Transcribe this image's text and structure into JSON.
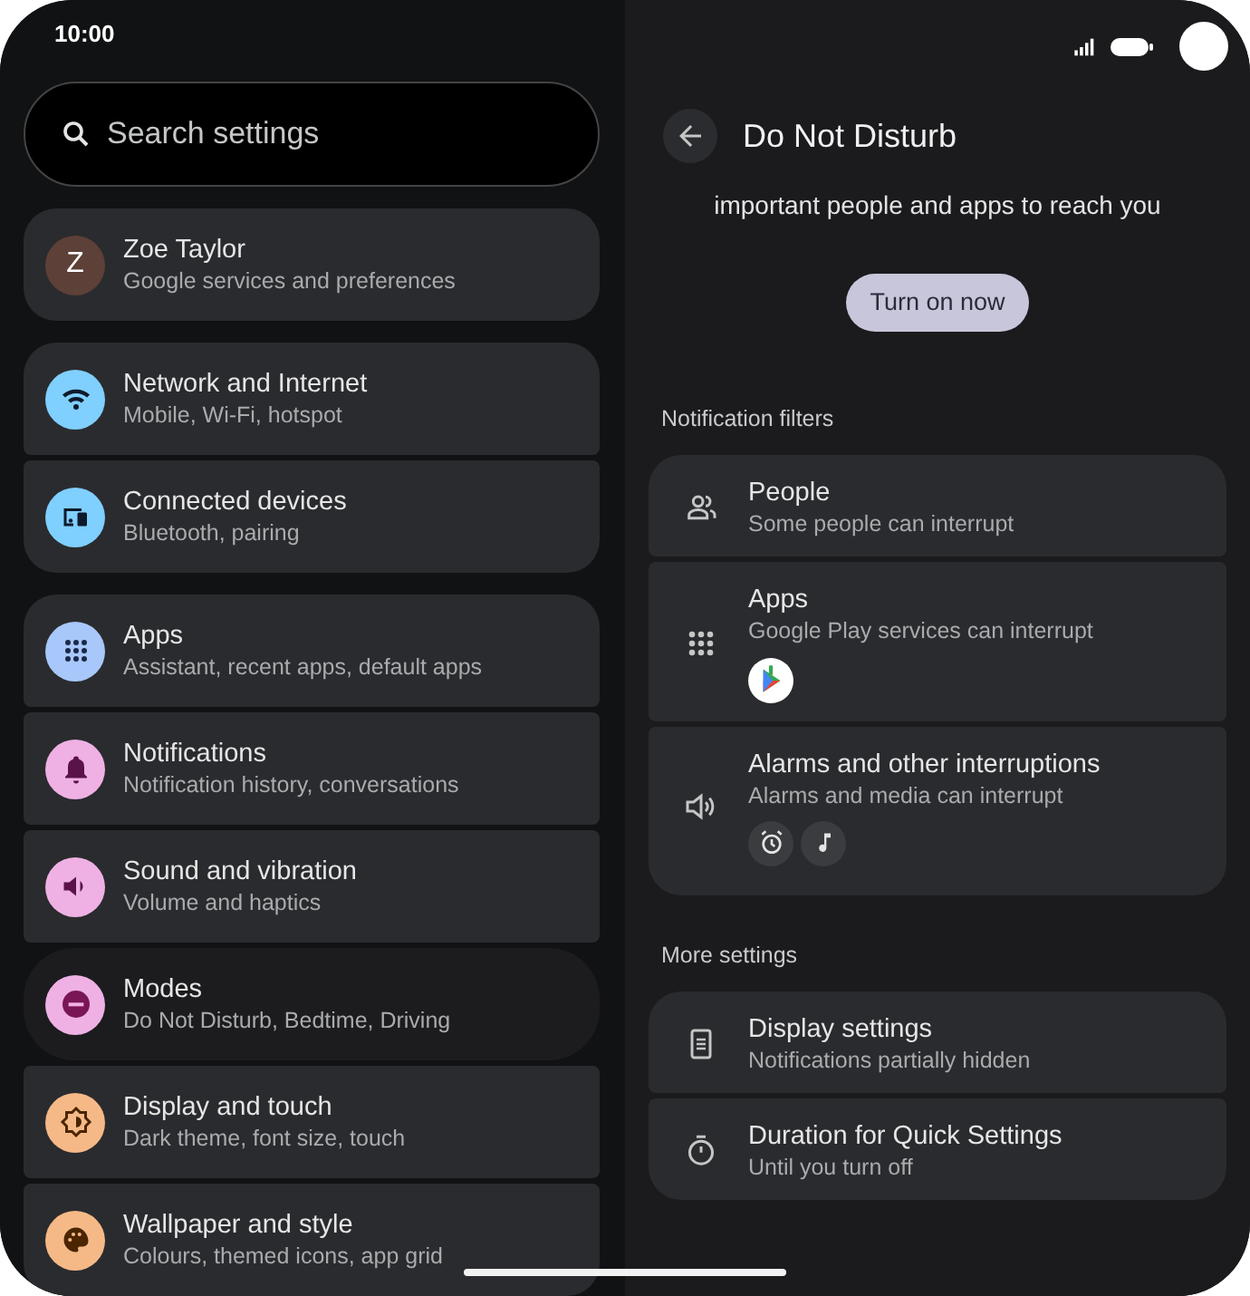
{
  "status_bar": {
    "time": "10:00"
  },
  "search": {
    "placeholder": "Search settings"
  },
  "settings_groups": [
    {
      "items": [
        {
          "kind": "avatar",
          "avatar_letter": "Z",
          "title": "Zoe Taylor",
          "subtitle": "Google services and preferences",
          "color": "#5d4037",
          "selected": false
        }
      ]
    },
    {
      "items": [
        {
          "kind": "icon",
          "title": "Network and Internet",
          "subtitle": "Mobile, Wi-Fi, hotspot",
          "color": "#7fcfff",
          "selected": false
        },
        {
          "kind": "icon",
          "title": "Connected devices",
          "subtitle": "Bluetooth, pairing",
          "color": "#7fcfff",
          "selected": false
        }
      ]
    },
    {
      "items": [
        {
          "kind": "icon",
          "title": "Apps",
          "subtitle": "Assistant, recent apps, default apps",
          "color": "#a8c7fa",
          "selected": false
        },
        {
          "kind": "icon",
          "title": "Notifications",
          "subtitle": "Notification history, conversations",
          "color": "#efb1e4",
          "selected": false
        },
        {
          "kind": "icon",
          "title": "Sound and vibration",
          "subtitle": "Volume and haptics",
          "color": "#efb1e4",
          "selected": false
        },
        {
          "kind": "icon",
          "title": "Modes",
          "subtitle": "Do Not Disturb, Bedtime, Driving",
          "color": "#efb1e4",
          "selected": true
        },
        {
          "kind": "icon",
          "title": "Display and touch",
          "subtitle": "Dark theme, font size, touch",
          "color": "#f5b987",
          "selected": false
        },
        {
          "kind": "icon",
          "title": "Wallpaper and style",
          "subtitle": "Colours, themed icons, app grid",
          "color": "#f5b987",
          "selected": false
        }
      ]
    }
  ],
  "detail": {
    "title": "Do Not Disturb",
    "description": "important people and apps to reach you",
    "button": "Turn on now",
    "sections": [
      {
        "title": "Notification filters",
        "items": [
          {
            "kind": "plain",
            "title": "People",
            "subtitle": "Some people can interrupt"
          },
          {
            "kind": "apps",
            "title": "Apps",
            "subtitle": "Google Play services can interrupt"
          },
          {
            "kind": "alarms",
            "title": "Alarms and other interruptions",
            "subtitle": "Alarms and media can interrupt"
          }
        ]
      },
      {
        "title": "More settings",
        "items": [
          {
            "kind": "plain",
            "title": "Display settings",
            "subtitle": "Notifications partially hidden"
          },
          {
            "kind": "plain",
            "title": "Duration for Quick Settings",
            "subtitle": "Until you turn off"
          }
        ]
      }
    ]
  }
}
